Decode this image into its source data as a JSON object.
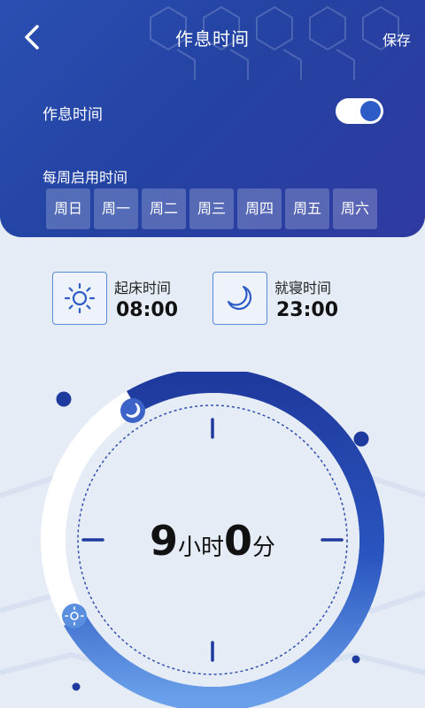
{
  "nav": {
    "title": "作息时间",
    "save_label": "保存"
  },
  "schedule_toggle": {
    "label": "作息时间",
    "enabled": true
  },
  "week": {
    "label": "每周启用时间",
    "days": [
      "周日",
      "周一",
      "周二",
      "周三",
      "周四",
      "周五",
      "周六"
    ]
  },
  "wake": {
    "label": "起床时间",
    "time": "08:00"
  },
  "sleep": {
    "label": "就寝时间",
    "time": "23:00"
  },
  "duration": {
    "hours": "9",
    "hours_unit": "小时",
    "minutes": "0",
    "minutes_unit": "分"
  },
  "colors": {
    "header": "#2a4fb2",
    "accent": "#2e5cc6",
    "arc_start": "#1f3a9e",
    "arc_end": "#6aa0ea",
    "dot": "#1f3a9e"
  },
  "icons": [
    "back-arrow-icon",
    "sun-icon",
    "moon-icon"
  ]
}
